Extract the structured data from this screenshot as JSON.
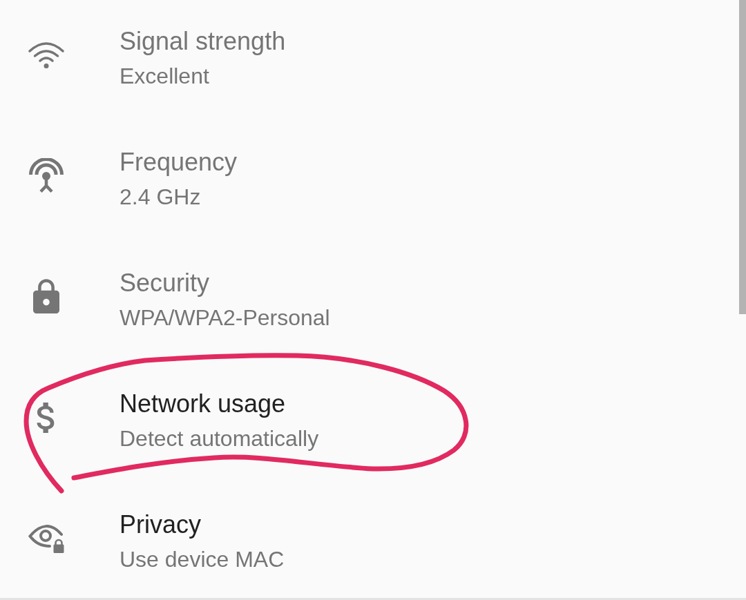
{
  "settings": [
    {
      "title": "Signal strength",
      "summary": "Excellent",
      "disabled": true
    },
    {
      "title": "Frequency",
      "summary": "2.4 GHz",
      "disabled": true
    },
    {
      "title": "Security",
      "summary": "WPA/WPA2-Personal",
      "disabled": true
    },
    {
      "title": "Network usage",
      "summary": "Detect automatically",
      "disabled": false
    },
    {
      "title": "Privacy",
      "summary": "Use device MAC",
      "disabled": false
    }
  ]
}
